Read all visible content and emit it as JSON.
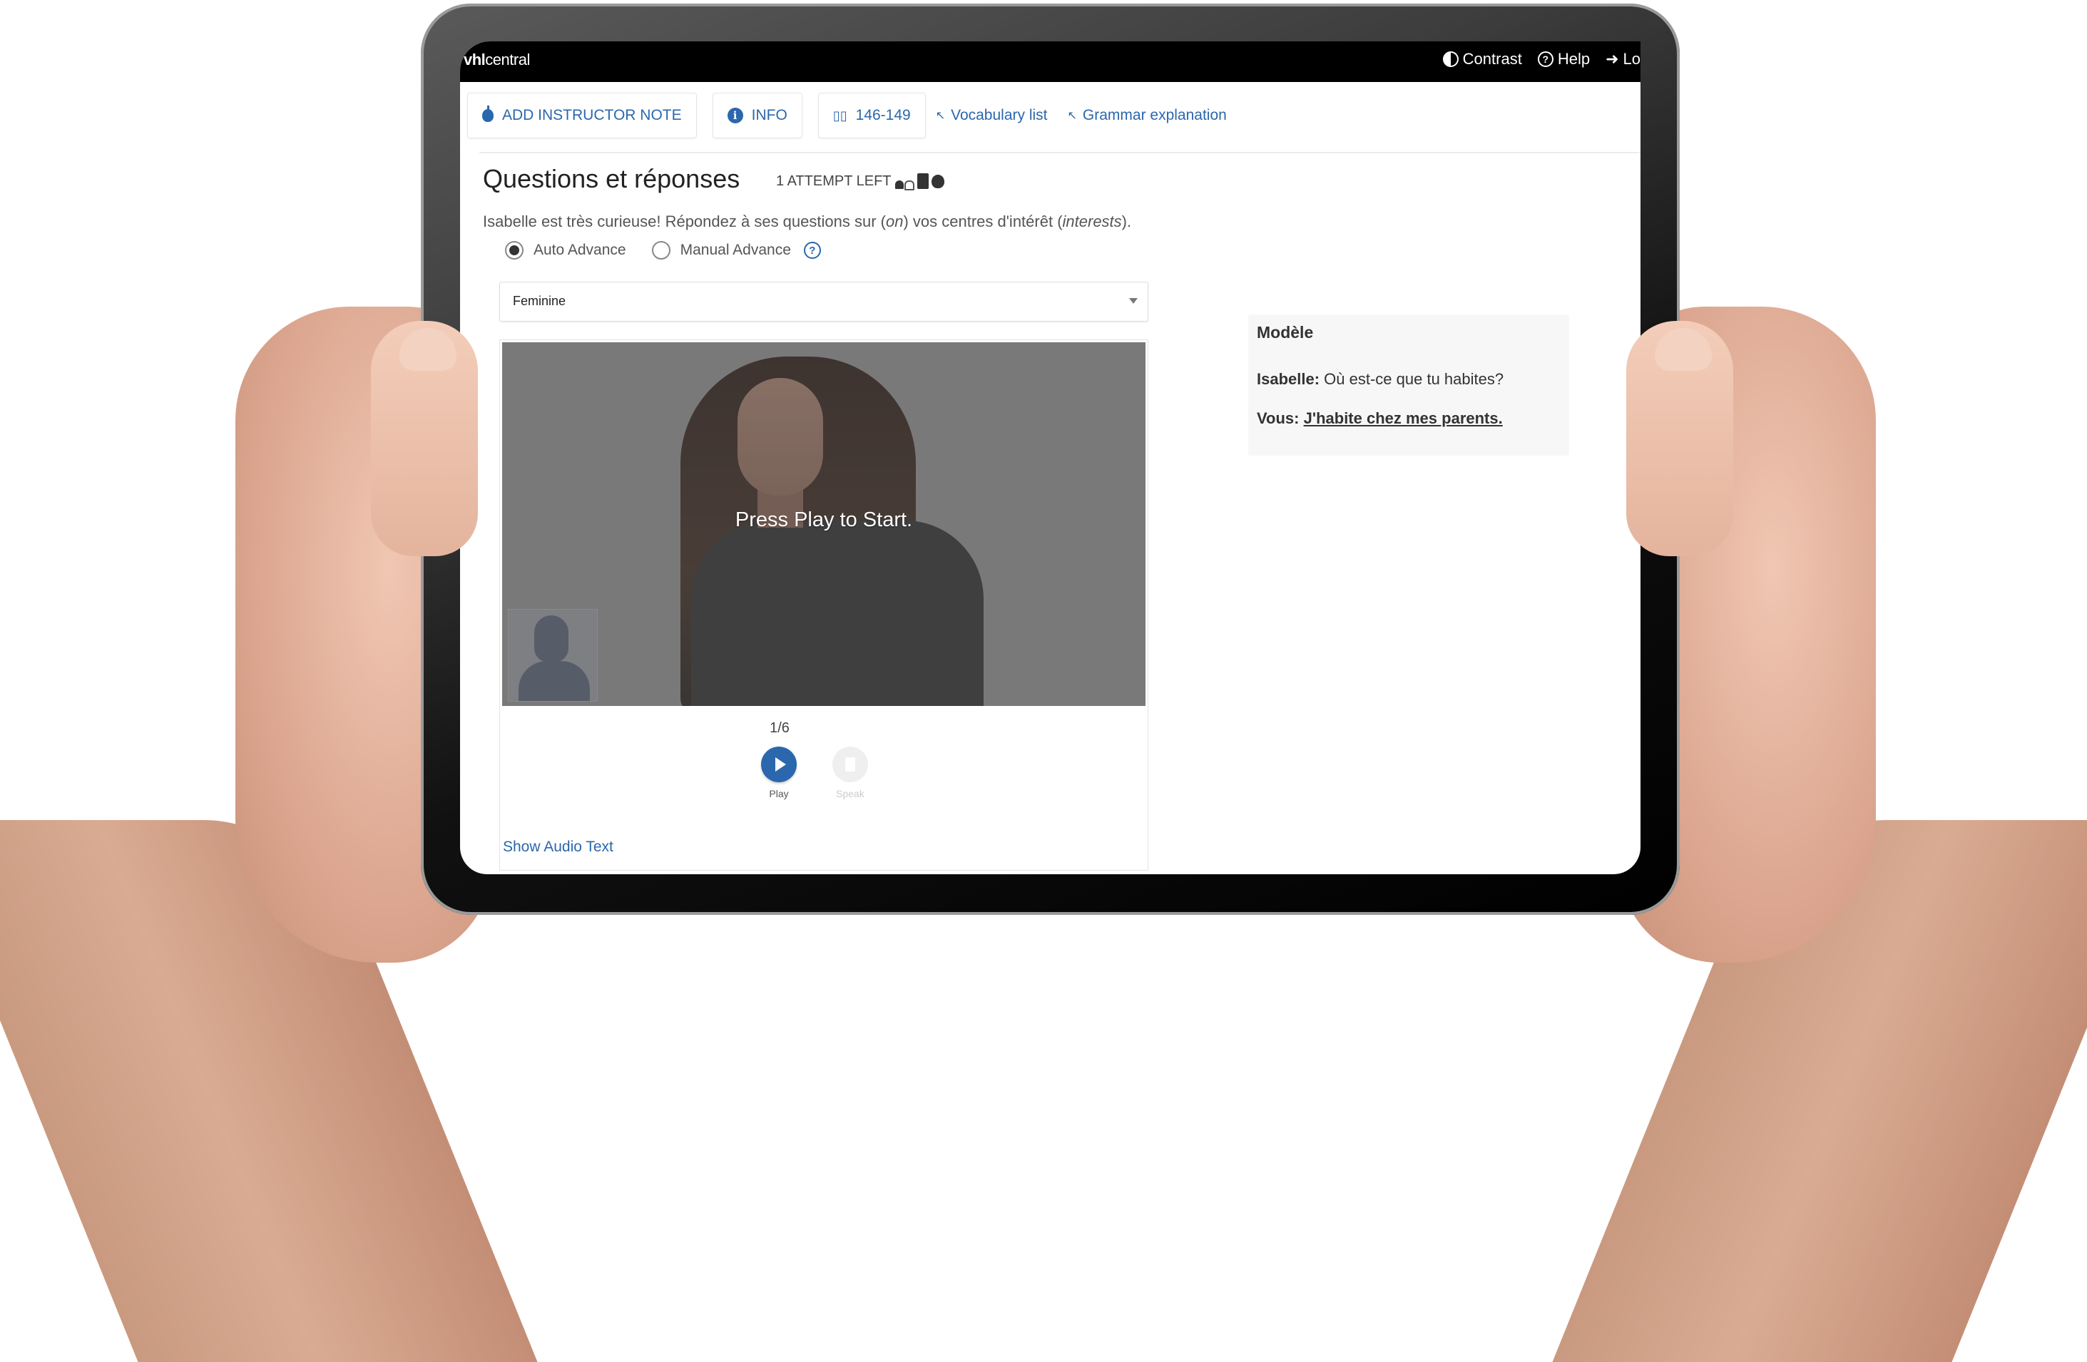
{
  "app": {
    "logo_bold": "vhl",
    "logo_rest": "central"
  },
  "topbar": {
    "actions": [
      {
        "icon": "contrast-icon",
        "label": "Contrast"
      },
      {
        "icon": "help-icon",
        "label": "Help"
      },
      {
        "icon": "logout-icon",
        "label": "Lo"
      }
    ]
  },
  "toolbar": {
    "add_note": "ADD INSTRUCTOR NOTE",
    "info": "INFO",
    "pages": "146-149",
    "vocab_link": "Vocabulary list",
    "grammar_link": "Grammar explanation",
    "info_glyph": "i",
    "link_arrow": "↖"
  },
  "activity": {
    "title": "Questions et réponses",
    "attempts": "1 ATTEMPT LEFT",
    "instructions_part1": "Isabelle est très curieuse! Répondez à ses questions sur (",
    "instructions_em1": "on",
    "instructions_part2": ") vos centres d'intérêt (",
    "instructions_em2": "interests",
    "instructions_part3": ")."
  },
  "advance": {
    "options": [
      {
        "label": "Auto Advance",
        "selected": true
      },
      {
        "label": "Manual Advance",
        "selected": false
      }
    ],
    "help_glyph": "?"
  },
  "voice_select": {
    "value": "Feminine"
  },
  "player": {
    "overlay_text": "Press Play to Start.",
    "counter": "1/6",
    "play_label": "Play",
    "speak_label": "Speak",
    "show_audio_text": "Show Audio Text"
  },
  "model": {
    "title": "Modèle",
    "speaker1": "Isabelle:",
    "line1": "Où est-ce que tu habites?",
    "speaker2": "Vous:",
    "line2": "J'habite chez mes parents."
  },
  "colors": {
    "accent": "#2b67ad",
    "topbar": "#000000"
  }
}
